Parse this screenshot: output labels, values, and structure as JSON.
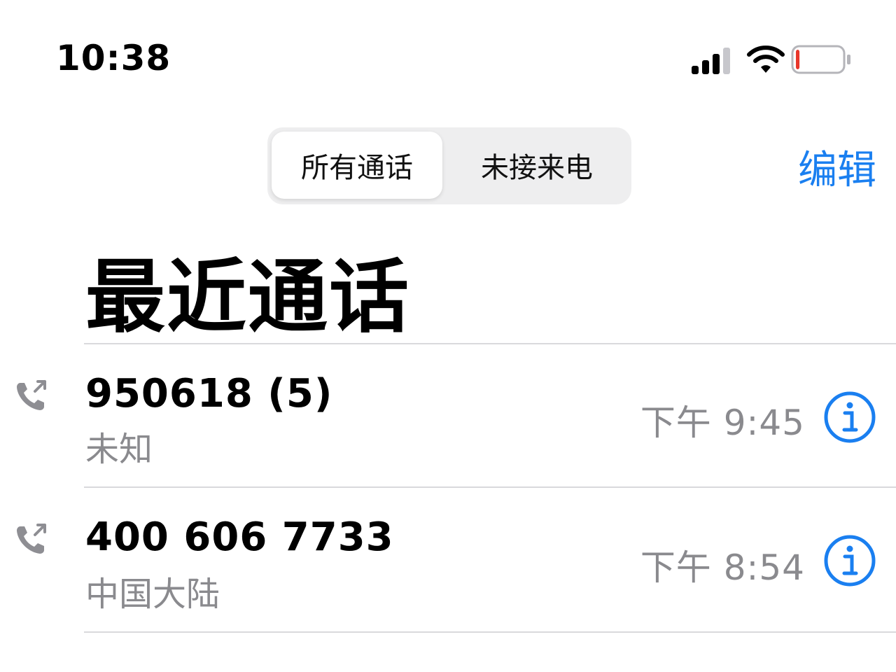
{
  "status_bar": {
    "time": "10:38",
    "battery_level_fraction": 0.08,
    "battery_color": "#e8362a"
  },
  "segmented_control": {
    "all_calls_label": "所有通话",
    "missed_calls_label": "未接来电",
    "selected": "all_calls_label"
  },
  "edit_label": "编辑",
  "page_title": "最近通话",
  "accent_color": "#1a7ff0",
  "calls": [
    {
      "number": "950618 (5)",
      "location": "未知",
      "time": "下午 9:45",
      "type": "outgoing",
      "icon": "outgoing-call-icon"
    },
    {
      "number": "400 606 7733",
      "location": "中国大陆",
      "time": "下午 8:54",
      "type": "outgoing",
      "icon": "outgoing-call-icon"
    }
  ]
}
